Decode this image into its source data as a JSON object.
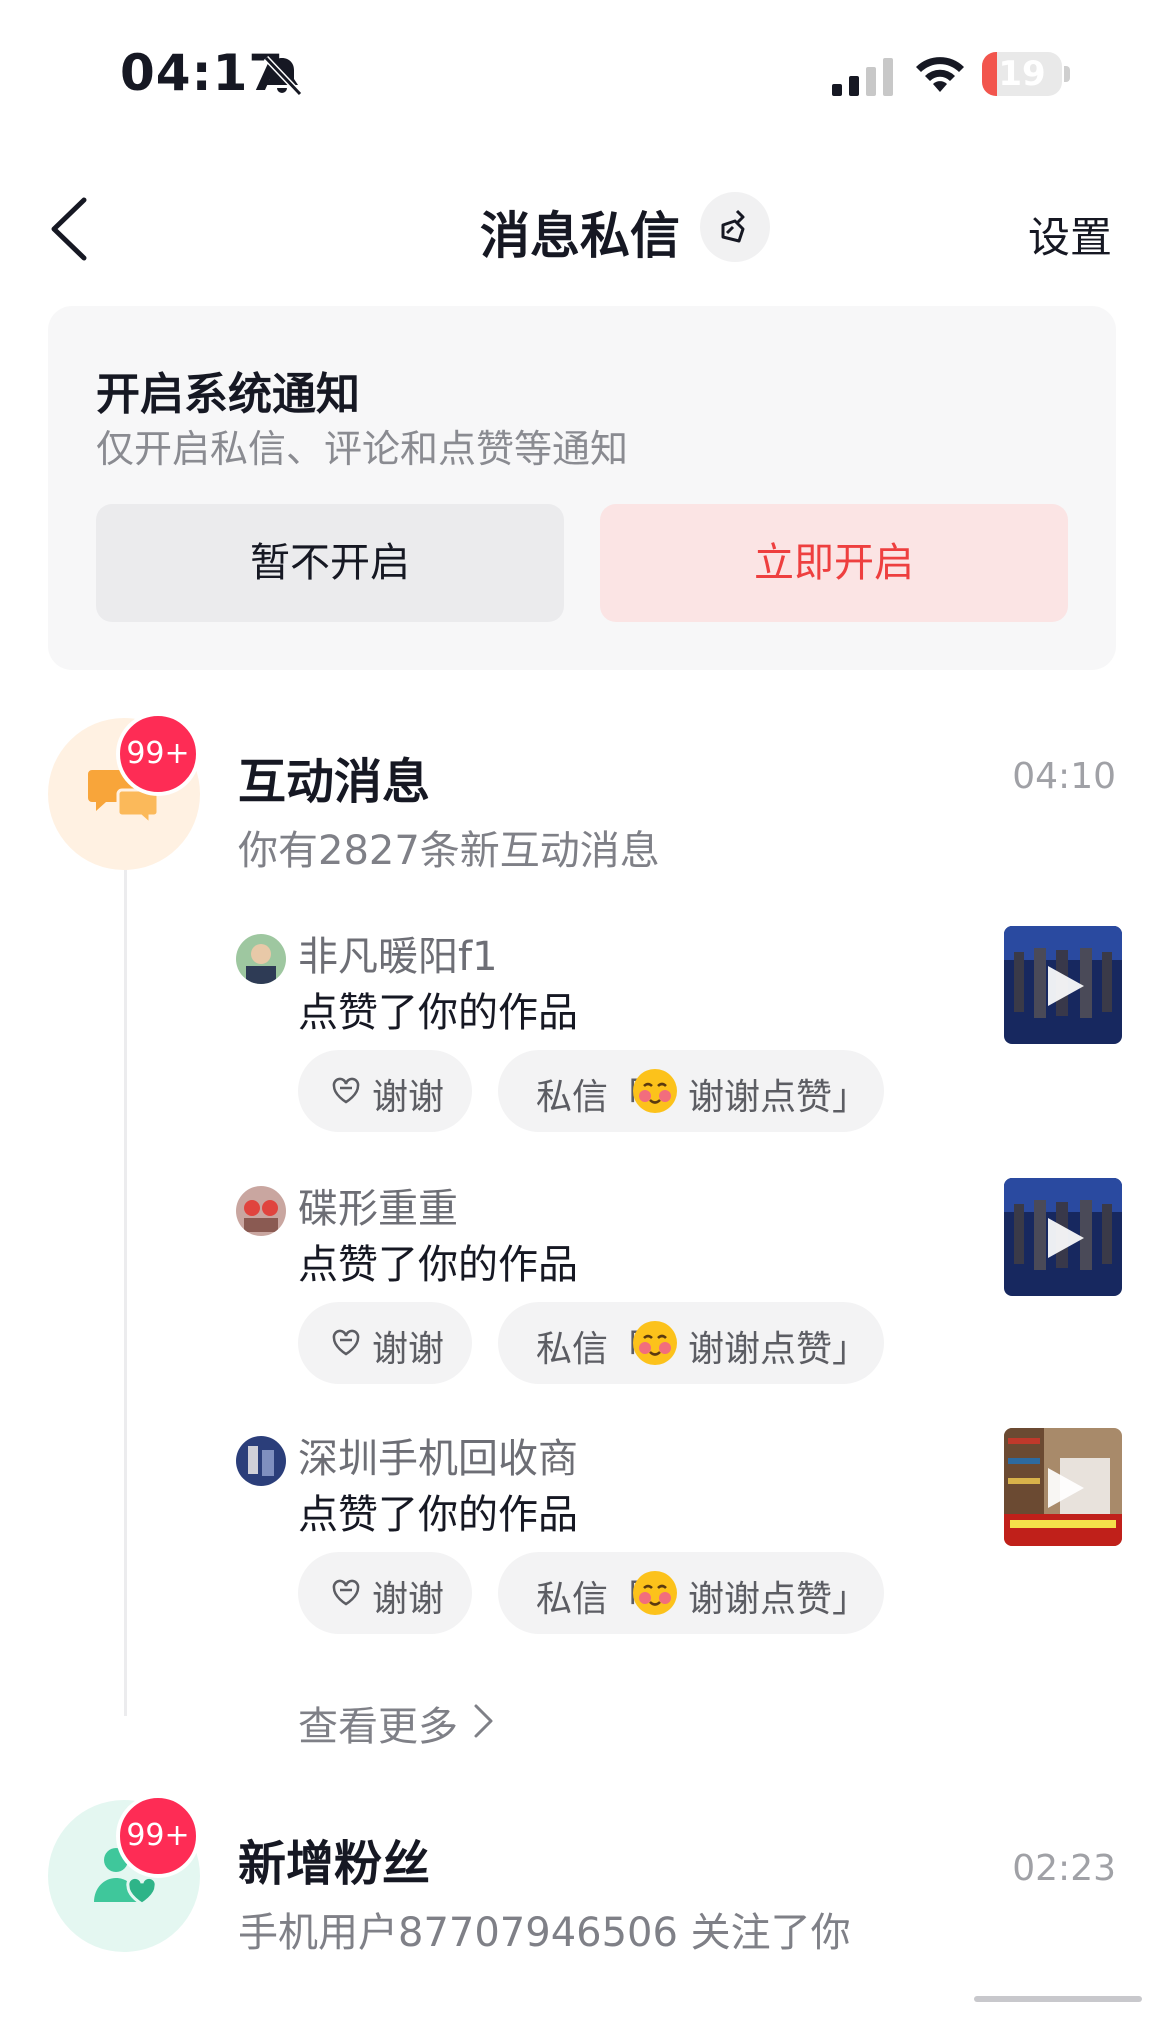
{
  "status_bar": {
    "time": "04:17",
    "battery": "19",
    "battery_level": 0.19
  },
  "nav": {
    "title": "消息私信",
    "settings": "设置"
  },
  "notify_card": {
    "title": "开启系统通知",
    "subtitle": "仅开启私信、评论和点赞等通知",
    "later_button": "暂不开启",
    "enable_button": "立即开启"
  },
  "interactions": {
    "badge": "99+",
    "title": "互动消息",
    "time": "04:10",
    "description": "你有2827条新互动消息",
    "items": [
      {
        "user": "非凡暖阳f1",
        "action": "点赞了你的作品",
        "thanks": "谢谢",
        "dm_prefix": "私信「",
        "dm_text": "谢谢点赞」"
      },
      {
        "user": "碟形重重",
        "action": "点赞了你的作品",
        "thanks": "谢谢",
        "dm_prefix": "私信「",
        "dm_text": "谢谢点赞」"
      },
      {
        "user": "深圳手机回收商",
        "action": "点赞了你的作品",
        "thanks": "谢谢",
        "dm_prefix": "私信「",
        "dm_text": "谢谢点赞」"
      }
    ],
    "see_more": "查看更多"
  },
  "new_fans": {
    "badge": "99+",
    "title": "新增粉丝",
    "time": "02:23",
    "description": "手机用户87707946506 关注了你"
  },
  "colors": {
    "accent_red": "#fe2c55",
    "enable_text": "#ee3f3f",
    "orange_icon": "#f8a53a",
    "green_icon": "#3fc79b"
  }
}
